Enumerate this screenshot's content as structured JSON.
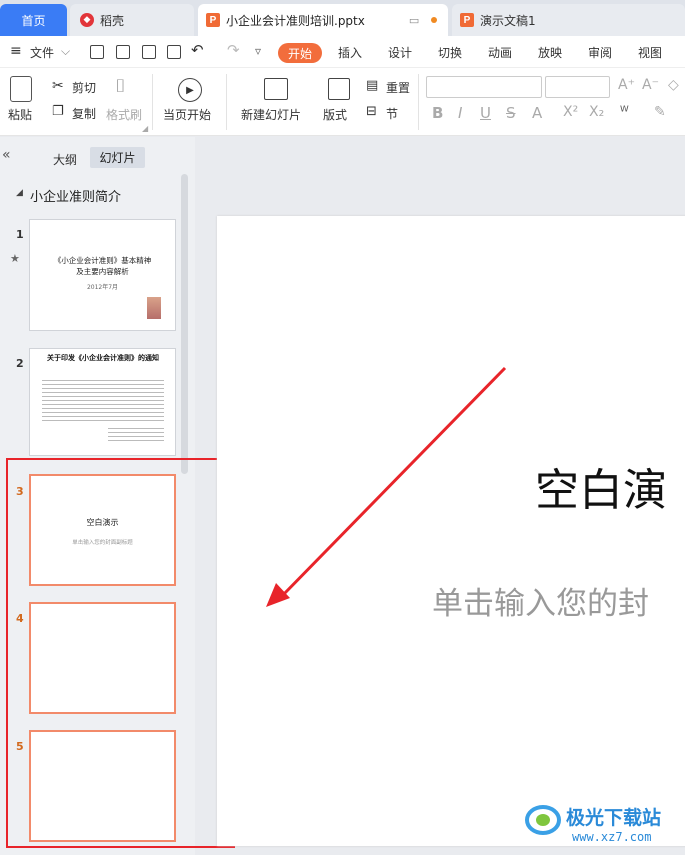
{
  "tabs": {
    "home": "首页",
    "daoke": "稻壳",
    "file": "小企业会计准则培训.pptx",
    "demo": "演示文稿1"
  },
  "menu": {
    "file": "文件",
    "start": "开始",
    "insert": "插入",
    "design": "设计",
    "transition": "切换",
    "animation": "动画",
    "slideshow": "放映",
    "review": "审阅",
    "view": "视图"
  },
  "ribbon": {
    "paste": "粘贴",
    "cut": "剪切",
    "copy": "复制",
    "format_painter": "格式刷",
    "from_current": "当页开始",
    "new_slide": "新建幻灯片",
    "layout": "版式",
    "reset": "重置",
    "section": "节"
  },
  "panel": {
    "outline_tab": "大纲",
    "slides_tab": "幻灯片",
    "section_title": "小企业准则简介"
  },
  "slides": [
    {
      "num": "1",
      "title": "《小企业会计准则》基本精神\n及主要内容解析",
      "date": "2012年7月"
    },
    {
      "num": "2",
      "title": "关于印发《小企业会计准则》的通知"
    },
    {
      "num": "3",
      "title": "空白演示",
      "subtitle": "单击输入您的封面副标题"
    },
    {
      "num": "4"
    },
    {
      "num": "5"
    }
  ],
  "canvas": {
    "title": "空白演",
    "subtitle": "单击输入您的封"
  },
  "watermark": {
    "name": "极光下载站",
    "url": "www.xz7.com"
  },
  "colors": {
    "accent": "#f26d3c",
    "home_tab": "#3a7cf5",
    "highlight_box": "#e8242a",
    "arrow": "#e8242a"
  }
}
